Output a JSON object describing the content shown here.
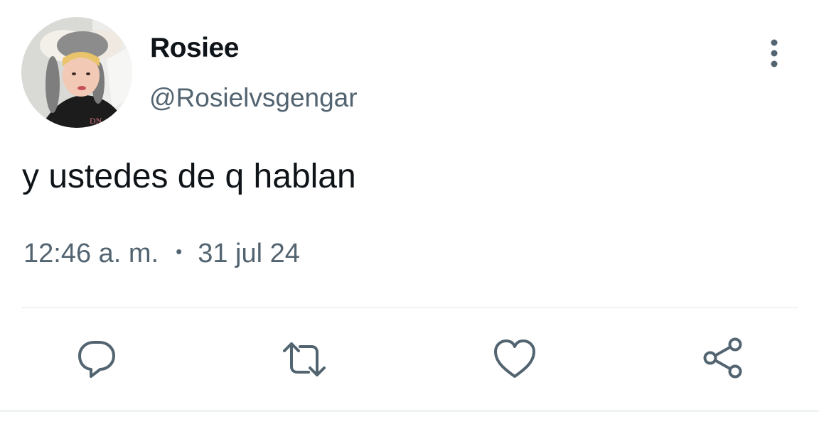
{
  "tweet": {
    "author": {
      "display_name": "Rosiee",
      "handle": "@Rosielvsgengar"
    },
    "text": "y ustedes de q hablan",
    "time": "12:46 a. m.",
    "separator": "•",
    "date": "31 jul 24"
  },
  "icons": {
    "more": "more-vertical-icon",
    "reply": "reply-icon",
    "retweet": "retweet-icon",
    "like": "heart-icon",
    "share": "share-icon"
  },
  "colors": {
    "text_primary": "#0f1419",
    "text_secondary": "#536471",
    "divider": "#eff3f4"
  }
}
